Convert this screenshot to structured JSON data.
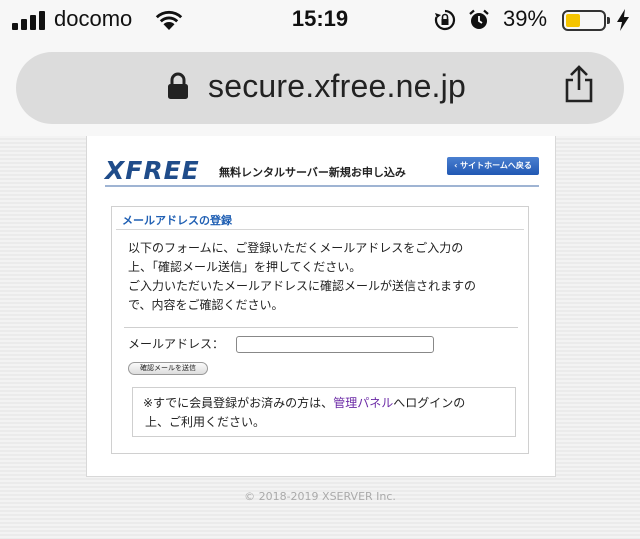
{
  "status_bar": {
    "carrier": "docomo",
    "time": "15:19",
    "battery_percent": "39%",
    "battery_level": 0.39,
    "icons": [
      "signal-icon",
      "wifi-icon",
      "rotation-lock-icon",
      "alarm-icon",
      "battery-icon",
      "charging-icon"
    ]
  },
  "browser": {
    "url": "secure.xfree.ne.jp",
    "icons": [
      "padlock-icon",
      "share-icon"
    ]
  },
  "header": {
    "logo": "XFREE",
    "tagline": "無料レンタルサーバー新規お申し込み",
    "home_button": "‹ サイトホームへ戻る"
  },
  "form": {
    "title": "メールアドレスの登録",
    "intro_line1": "以下のフォームに、ご登録いただくメールアドレスをご入力の",
    "intro_line2": "上、「確認メール送信」を押してください。",
    "intro_line3": "ご入力いただいたメールアドレスに確認メールが送信されますの",
    "intro_line4": "で、内容をご確認ください。",
    "email_label": "メールアドレス：",
    "email_value": "",
    "submit_label": "確認メールを送信",
    "notice_before": "※すでに会員登録がお済みの方は、",
    "notice_link": "管理パネル",
    "notice_after": "へログインの",
    "notice_line2": "上、ご利用ください。"
  },
  "footer": {
    "copyright": "© 2018-2019 XSERVER Inc."
  },
  "colors": {
    "brand_blue": "#1f4c8a",
    "link_purple": "#6b2aa6",
    "button_blue": "#2158b3",
    "battery_yellow": "#f5c400"
  }
}
